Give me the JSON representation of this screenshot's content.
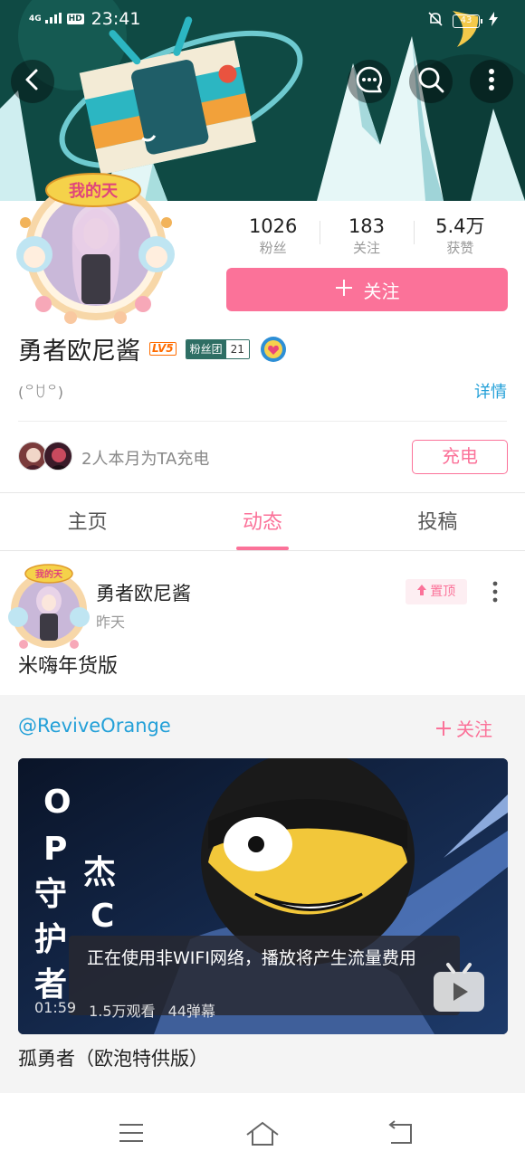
{
  "status_bar": {
    "network": "4G",
    "hd": "HD",
    "time": "23:41",
    "battery": "43"
  },
  "top_buttons": {
    "back": "chevron-left-icon",
    "message": "message-icon",
    "search": "search-icon",
    "more": "more-vertical-icon"
  },
  "profile": {
    "stats": [
      {
        "value": "1026",
        "label": "粉丝"
      },
      {
        "value": "183",
        "label": "关注"
      },
      {
        "value": "5.4万",
        "label": "获赞"
      }
    ],
    "follow_button": "关注",
    "name": "勇者欧尼酱",
    "level": "LV5",
    "fan_club": {
      "label": "粉丝团",
      "level": "21"
    },
    "signature": "(꒪ꇴ꒪)",
    "detail_link": "详情",
    "charge_text": "2人本月为TA充电",
    "charge_button": "充电"
  },
  "tabs": [
    {
      "label": "主页",
      "active": false
    },
    {
      "label": "动态",
      "active": true
    },
    {
      "label": "投稿",
      "active": false
    }
  ],
  "post": {
    "author": "勇者欧尼酱",
    "time": "昨天",
    "pinned": "置顶",
    "text": "米嗨年货版",
    "repost": {
      "user": "@ReviveOrange",
      "follow": "关注",
      "video": {
        "overlay_left": "OP守护者",
        "overlay_right": "杰C",
        "wifi_tip": "正在使用非WIFI网络，播放将产生流量费用",
        "duration": "01:59",
        "views": "1.5万观看",
        "danmaku": "44弹幕"
      },
      "title": "孤勇者（欧泡特供版）"
    }
  },
  "colors": {
    "accent": "#fb7299",
    "link": "#23a0d8",
    "banner": "#0f4a44"
  }
}
